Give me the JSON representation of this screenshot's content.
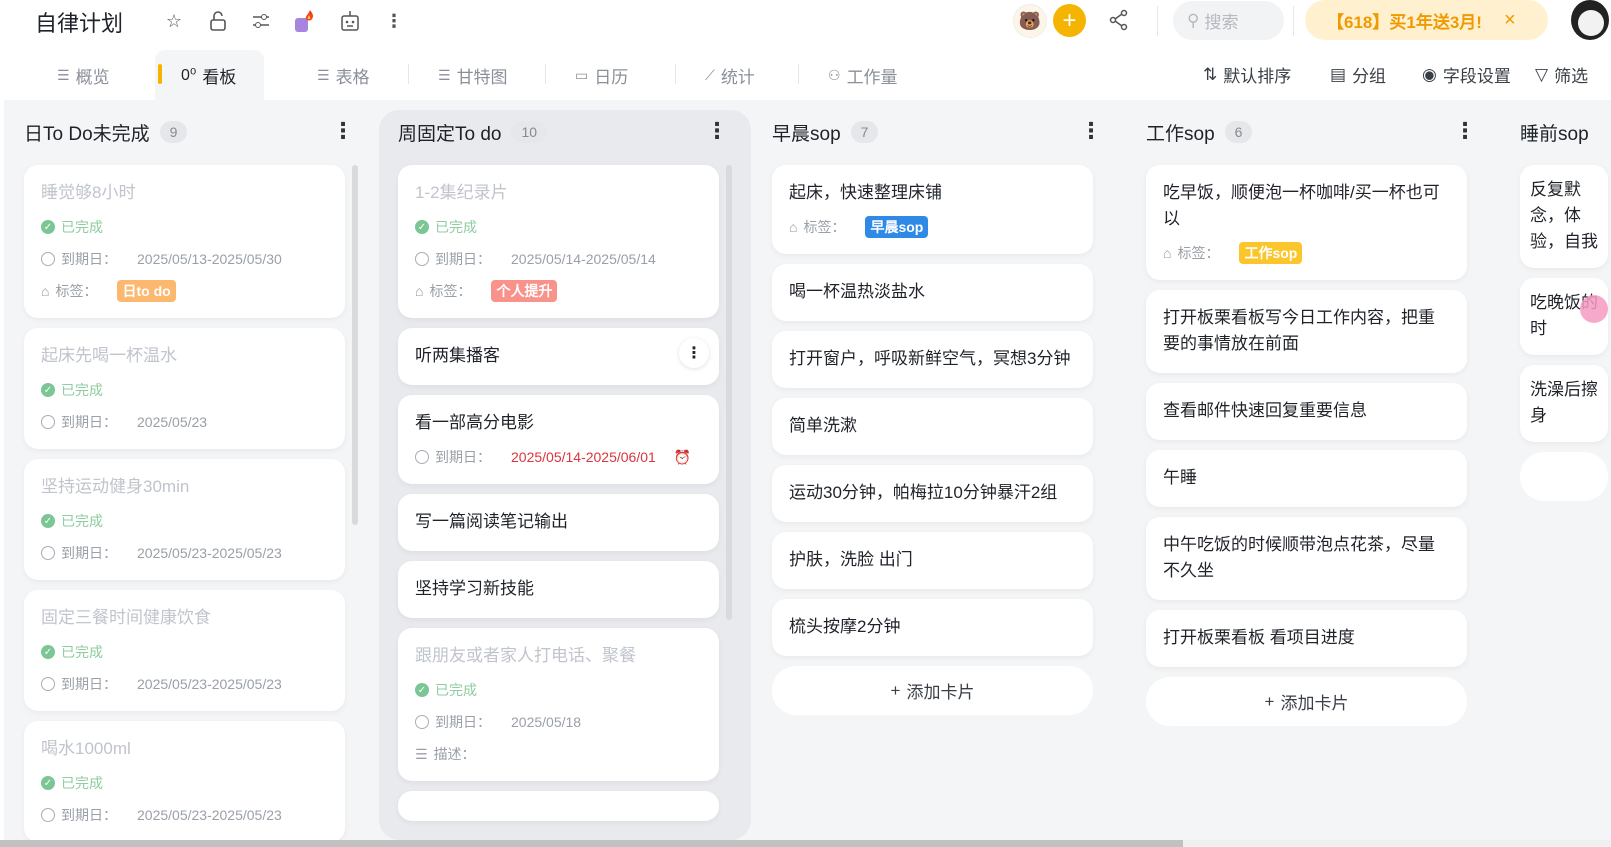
{
  "header": {
    "title": "自律计划",
    "search_placeholder": "搜索",
    "promo": "【618】买1年送3月!",
    "promo_close": "×"
  },
  "tabs": [
    {
      "label": "概览",
      "icon": "list-icon"
    },
    {
      "label": "看板",
      "icon": "kanban-icon",
      "active": true
    },
    {
      "label": "表格",
      "icon": "table-icon"
    },
    {
      "label": "甘特图",
      "icon": "gantt-icon"
    },
    {
      "label": "日历",
      "icon": "calendar-icon"
    },
    {
      "label": "统计",
      "icon": "chart-icon"
    },
    {
      "label": "工作量",
      "icon": "workload-icon"
    }
  ],
  "toolbar": {
    "sort": "默认排序",
    "group": "分组",
    "fields": "字段设置",
    "filter": "筛选"
  },
  "colors": {
    "accent": "#f5b400",
    "done": "#7cc695",
    "overdue": "#d9363e"
  },
  "add_card_label": "添加卡片",
  "columns": [
    {
      "title": "日To Do未完成",
      "count": "9",
      "cards": [
        {
          "title": "睡觉够8小时",
          "done": true,
          "status": "已完成",
          "due_label": "到期日：",
          "due": "2025/05/13-2025/05/30",
          "tag_label": "标签：",
          "tag": "日to do",
          "tag_color": "#fbb86e"
        },
        {
          "title": "起床先喝一杯温水",
          "done": true,
          "status": "已完成",
          "due_label": "到期日：",
          "due": "2025/05/23"
        },
        {
          "title": "坚持运动健身30min",
          "done": true,
          "status": "已完成",
          "due_label": "到期日：",
          "due": "2025/05/23-2025/05/23"
        },
        {
          "title": "固定三餐时间健康饮食",
          "done": true,
          "status": "已完成",
          "due_label": "到期日：",
          "due": "2025/05/23-2025/05/23"
        },
        {
          "title": "喝水1000ml",
          "done": true,
          "status": "已完成",
          "due_label": "到期日：",
          "due": "2025/05/23-2025/05/23"
        }
      ]
    },
    {
      "title": "周固定To do",
      "count": "10",
      "cards": [
        {
          "title": "1-2集纪录片",
          "done": true,
          "status": "已完成",
          "due_label": "到期日：",
          "due": "2025/05/14-2025/05/14",
          "tag_label": "标签：",
          "tag": "个人提升",
          "tag_color": "#f8928a"
        },
        {
          "title": "听两集播客",
          "more": true
        },
        {
          "title": "看一部高分电影",
          "due_label": "到期日：",
          "due": "2025/05/14-2025/06/01",
          "overdue": true,
          "alarm": true
        },
        {
          "title": "写一篇阅读笔记输出"
        },
        {
          "title": "坚持学习新技能"
        },
        {
          "title": "跟朋友或者家人打电话、聚餐",
          "done": true,
          "status": "已完成",
          "due_label": "到期日：",
          "due": "2025/05/18",
          "desc_label": "描述："
        },
        {
          "title": " "
        }
      ]
    },
    {
      "title": "早晨sop",
      "count": "7",
      "add": true,
      "cards": [
        {
          "title": "起床，快速整理床铺",
          "tag_label": "标签：",
          "tag": "早晨sop",
          "tag_color": "#2f8ae6"
        },
        {
          "title": "喝一杯温热淡盐水"
        },
        {
          "title": "打开窗户，呼吸新鲜空气，冥想3分钟"
        },
        {
          "title": "简单洗漱"
        },
        {
          "title": "运动30分钟，帕梅拉10分钟暴汗2组"
        },
        {
          "title": "护肤，洗脸 出门"
        },
        {
          "title": "梳头按摩2分钟"
        }
      ]
    },
    {
      "title": "工作sop",
      "count": "6",
      "add": true,
      "cards": [
        {
          "title": "吃早饭，顺便泡一杯咖啡/买一杯也可以",
          "tag_label": "标签：",
          "tag": "工作sop",
          "tag_color": "#fbc52c"
        },
        {
          "title": "打开板栗看板写今日工作内容，把重要的事情放在前面"
        },
        {
          "title": "查看邮件快速回复重要信息"
        },
        {
          "title": "午睡"
        },
        {
          "title": "中午吃饭的时候顺带泡点花茶，尽量不久坐"
        },
        {
          "title": "打开板栗看板 看项目进度"
        }
      ]
    },
    {
      "title": "睡前sop",
      "add": true,
      "add_blank": true,
      "cards": [
        {
          "title": "反复默念，体验，自我"
        },
        {
          "title": "吃晚饭的时"
        },
        {
          "title": "洗澡后擦身"
        }
      ]
    }
  ]
}
